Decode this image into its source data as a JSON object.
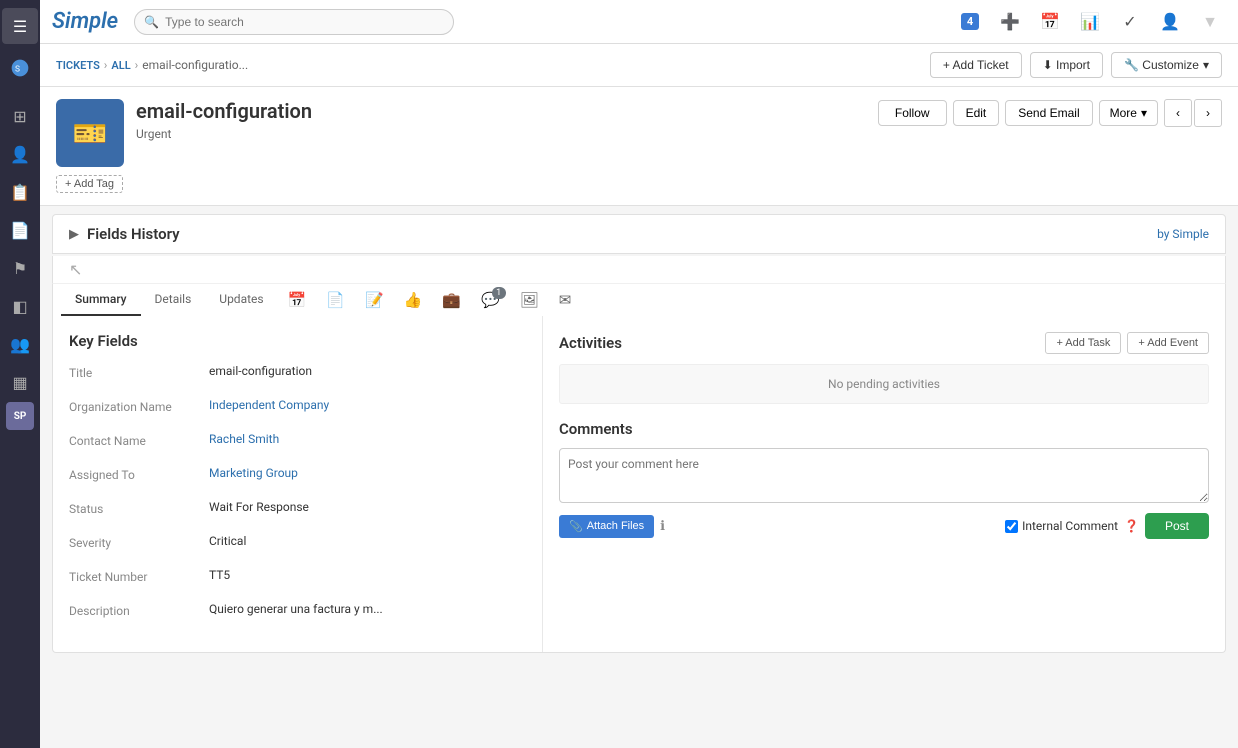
{
  "app": {
    "logo": "Simple",
    "search_placeholder": "Type to search"
  },
  "top_nav": {
    "badge_count": "4",
    "icons": [
      "grid-icon",
      "plus-icon",
      "calendar-icon",
      "chart-icon",
      "check-icon",
      "user-icon"
    ]
  },
  "breadcrumb": {
    "section": "TICKETS",
    "all_label": "All",
    "current": "email-configuratio..."
  },
  "breadcrumb_actions": {
    "add_ticket": "+ Add Ticket",
    "import": "⬇ Import",
    "customize": "🔧 Customize"
  },
  "record": {
    "title": "email-configuration",
    "subtitle": "Urgent",
    "follow_label": "Follow",
    "edit_label": "Edit",
    "send_email_label": "Send Email",
    "more_label": "More",
    "add_tag_label": "+ Add Tag"
  },
  "fields_history": {
    "section_title": "Fields History",
    "by_simple": "by Simple"
  },
  "tabs": [
    {
      "id": "summary",
      "label": "Summary",
      "active": true
    },
    {
      "id": "details",
      "label": "Details",
      "active": false
    },
    {
      "id": "updates",
      "label": "Updates",
      "active": false
    },
    {
      "id": "calendar",
      "label": "",
      "icon": "calendar-icon",
      "active": false
    },
    {
      "id": "doc",
      "label": "",
      "icon": "document-icon",
      "active": false
    },
    {
      "id": "edit-doc",
      "label": "",
      "icon": "edit-doc-icon",
      "active": false
    },
    {
      "id": "thumbs-up",
      "label": "",
      "icon": "thumbsup-icon",
      "active": false
    },
    {
      "id": "briefcase",
      "label": "",
      "icon": "briefcase-icon",
      "active": false
    },
    {
      "id": "chat",
      "label": "",
      "icon": "chat-icon",
      "badge": "1",
      "active": false
    },
    {
      "id": "image",
      "label": "",
      "icon": "image-icon",
      "active": false
    },
    {
      "id": "email",
      "label": "",
      "icon": "email-icon",
      "active": false
    }
  ],
  "key_fields": {
    "title": "Key Fields",
    "fields": [
      {
        "label": "Title",
        "value": "email-configuration",
        "type": "text"
      },
      {
        "label": "Organization Name",
        "value": "Independent Company",
        "type": "link"
      },
      {
        "label": "Contact Name",
        "value": "Rachel Smith",
        "type": "link"
      },
      {
        "label": "Assigned To",
        "value": "Marketing Group",
        "type": "link"
      },
      {
        "label": "Status",
        "value": "Wait For Response",
        "type": "text"
      },
      {
        "label": "Severity",
        "value": "Critical",
        "type": "text"
      },
      {
        "label": "Ticket Number",
        "value": "TT5",
        "type": "text"
      },
      {
        "label": "Description",
        "value": "Quiero generar una factura y m...",
        "type": "text"
      }
    ]
  },
  "activities": {
    "title": "Activities",
    "add_task_label": "+ Add Task",
    "add_event_label": "+ Add Event",
    "no_activities_text": "No pending activities"
  },
  "comments": {
    "title": "Comments",
    "placeholder": "Post your comment here",
    "attach_label": "Attach Files",
    "internal_comment_label": "Internal Comment",
    "post_label": "Post"
  }
}
